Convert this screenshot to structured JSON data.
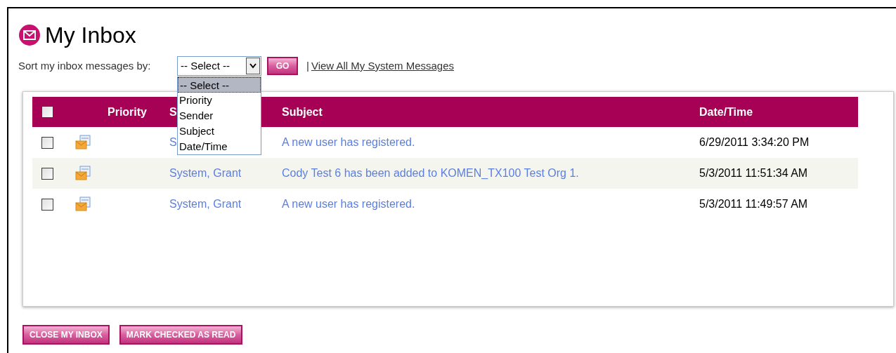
{
  "title": "My Inbox",
  "sort": {
    "label": "Sort my inbox messages by:",
    "value": "-- Select --",
    "options": [
      {
        "label": "-- Select --",
        "selected": true
      },
      {
        "label": "Priority",
        "selected": false
      },
      {
        "label": "Sender",
        "selected": false
      },
      {
        "label": "Subject",
        "selected": false
      },
      {
        "label": "Date/Time",
        "selected": false
      }
    ],
    "go": "GO",
    "separator": "|",
    "link": "View All My System Messages"
  },
  "table": {
    "select_all": {
      "checked": false
    },
    "columns": [
      "Priority",
      "S",
      "Subject",
      "Date/Time"
    ],
    "rows": [
      {
        "checked": false,
        "sender": "S",
        "subject": "A new user has registered.",
        "date": "6/29/2011 3:34:20 PM"
      },
      {
        "checked": false,
        "sender": "System, Grant",
        "subject": "Cody Test 6 has been added to KOMEN_TX100 Test Org 1.",
        "date": "5/3/2011 11:51:34 AM"
      },
      {
        "checked": false,
        "sender": "System, Grant",
        "subject": "A new user has registered.",
        "date": "5/3/2011 11:49:57 AM"
      }
    ]
  },
  "buttons": [
    "CLOSE MY INBOX",
    "MARK CHECKED AS READ"
  ]
}
